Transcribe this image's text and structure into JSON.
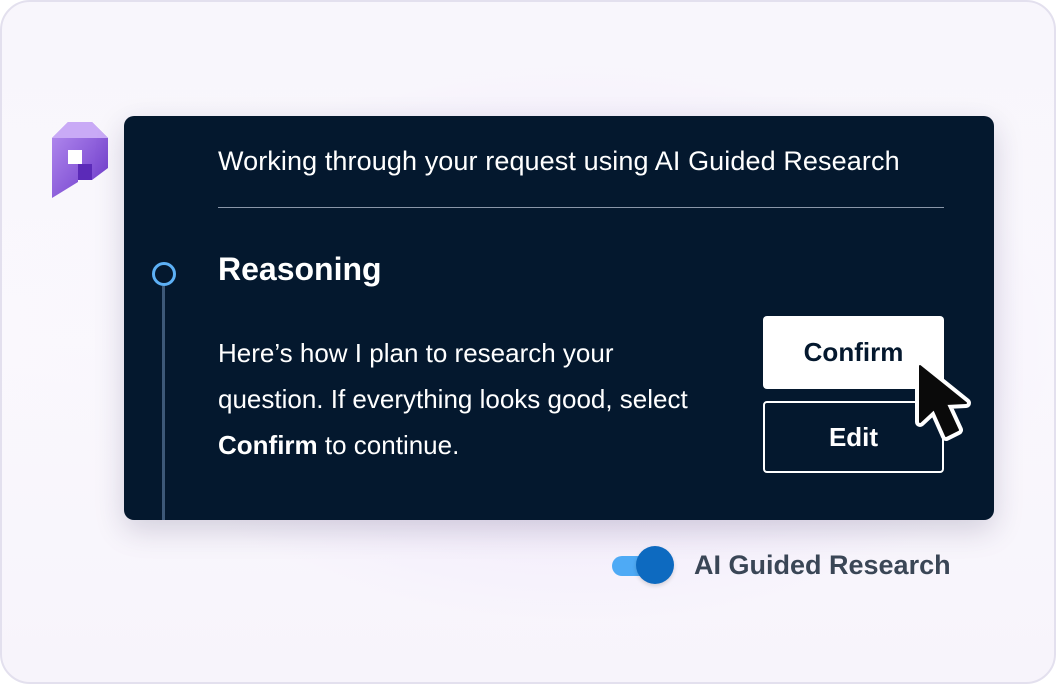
{
  "card": {
    "title": "Working through your request using AI Guided Research",
    "step": {
      "heading": "Reasoning",
      "body_part1": "Here’s how I plan to research your question. If everything looks good, select ",
      "body_emphasis": "Confirm",
      "body_part2": " to continue."
    },
    "buttons": {
      "confirm_label": "Confirm",
      "edit_label": "Edit"
    }
  },
  "toggle": {
    "label": "AI Guided Research",
    "state": "on"
  },
  "icons": {
    "logo": "brand-logo-icon",
    "cursor": "mouse-pointer-icon",
    "timeline": "timeline-step-icon"
  },
  "colors": {
    "card_background": "#04182e",
    "accent": "#5db0f5",
    "toggle_track": "#4eaaf5",
    "toggle_knob": "#0d6ac0",
    "logo_purple": "#7b47d8"
  }
}
